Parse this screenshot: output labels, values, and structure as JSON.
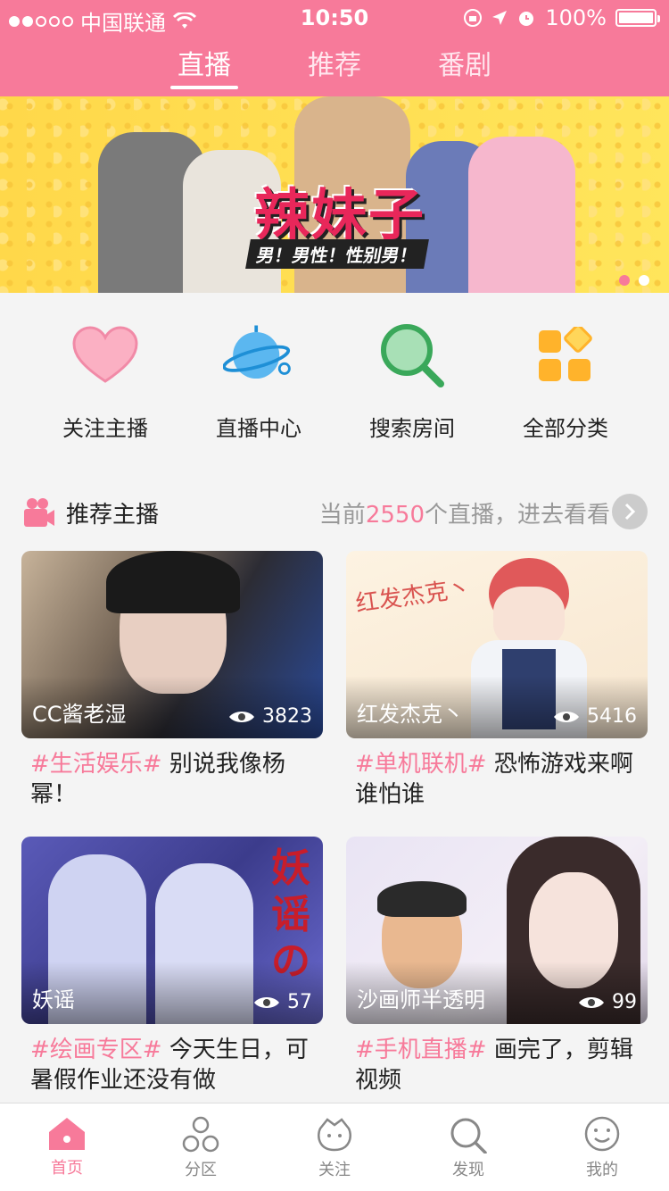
{
  "status_bar": {
    "carrier": "中国联通",
    "time": "10:50",
    "battery": "100%"
  },
  "header": {
    "tabs": [
      {
        "label": "直播",
        "active": true
      },
      {
        "label": "推荐",
        "active": false
      },
      {
        "label": "番剧",
        "active": false
      }
    ]
  },
  "banner": {
    "title": "辣妹子",
    "subtitle": "男！男性！性别男！",
    "page_count": 2,
    "active_page": 1
  },
  "quick_nav": [
    {
      "label": "关注主播",
      "icon": "heart-icon"
    },
    {
      "label": "直播中心",
      "icon": "planet-icon"
    },
    {
      "label": "搜索房间",
      "icon": "search-icon"
    },
    {
      "label": "全部分类",
      "icon": "categories-icon"
    }
  ],
  "section": {
    "title": "推荐主播",
    "more_prefix": "当前",
    "count": "2550",
    "more_suffix": "个直播，进去看看"
  },
  "cards": [
    {
      "name": "CC酱老湿",
      "views": "3823",
      "tag": "#生活娱乐#",
      "text": " 别说我像杨幂！"
    },
    {
      "name": "红发杰克丶",
      "views": "5416",
      "tag": "#单机联机#",
      "text": " 恐怖游戏来啊谁怕谁"
    },
    {
      "name": "妖谣",
      "views": "57",
      "tag": "#绘画专区#",
      "text": " 今天生日，可暑假作业还没有做"
    },
    {
      "name": "沙画师半透明",
      "views": "99",
      "tag": "#手机直播#",
      "text": " 画完了，剪辑视频"
    }
  ],
  "tab_bar": [
    {
      "label": "首页",
      "icon": "home-icon",
      "active": true
    },
    {
      "label": "分区",
      "icon": "category-icon",
      "active": false
    },
    {
      "label": "关注",
      "icon": "follow-icon",
      "active": false
    },
    {
      "label": "发现",
      "icon": "discover-icon",
      "active": false
    },
    {
      "label": "我的",
      "icon": "profile-icon",
      "active": false
    }
  ],
  "colors": {
    "accent": "#f77a9a",
    "banner_bg": "#ffd84a"
  }
}
